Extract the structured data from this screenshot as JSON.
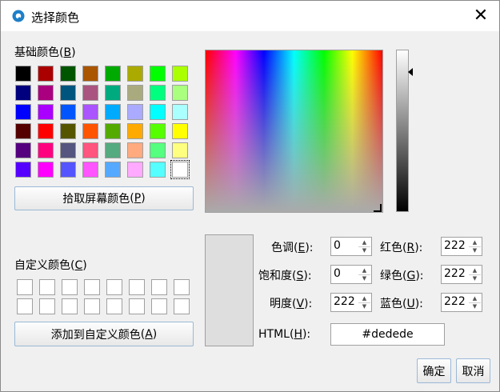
{
  "window": {
    "title": "选择颜色",
    "app_icon": "qt-logo-icon",
    "close_glyph": "✕"
  },
  "basic_colors": {
    "label": "基础颜色",
    "mnemonic": "B",
    "swatches": [
      "#000000",
      "#aa0000",
      "#005500",
      "#aa5500",
      "#00aa00",
      "#aaaa00",
      "#00ff00",
      "#aaff00",
      "#00007f",
      "#aa007f",
      "#00557f",
      "#aa557f",
      "#00aa7f",
      "#aaaa7f",
      "#00ff7f",
      "#aaff7f",
      "#0000ff",
      "#aa00ff",
      "#0055ff",
      "#aa55ff",
      "#00aaff",
      "#aaaaff",
      "#00ffff",
      "#aaffff",
      "#550000",
      "#ff0000",
      "#555500",
      "#ff5500",
      "#55aa00",
      "#ffaa00",
      "#55ff00",
      "#ffff00",
      "#55007f",
      "#ff007f",
      "#55557f",
      "#ff557f",
      "#55aa7f",
      "#ffaa7f",
      "#55ff7f",
      "#ffff7f",
      "#5500ff",
      "#ff00ff",
      "#5555ff",
      "#ff55ff",
      "#55aaff",
      "#ffaaff",
      "#55ffff",
      "#ffffff"
    ],
    "selected_index": 47
  },
  "pick_screen_button": {
    "label": "拾取屏幕颜色",
    "mnemonic": "P"
  },
  "custom_colors": {
    "label": "自定义颜色",
    "mnemonic": "C",
    "count": 16
  },
  "add_custom_button": {
    "label": "添加到自定义颜色",
    "mnemonic": "A"
  },
  "fields": {
    "hue": {
      "label": "色调",
      "mnemonic": "E",
      "value": "0"
    },
    "saturation": {
      "label": "饱和度",
      "mnemonic": "S",
      "value": "0"
    },
    "value": {
      "label": "明度",
      "mnemonic": "V",
      "value": "222"
    },
    "red": {
      "label": "红色",
      "mnemonic": "R",
      "value": "222"
    },
    "green": {
      "label": "绿色",
      "mnemonic": "G",
      "value": "222"
    },
    "blue": {
      "label": "蓝色",
      "mnemonic": "U",
      "value": "222"
    },
    "html": {
      "label": "HTML",
      "mnemonic": "H",
      "value": "#dedede"
    }
  },
  "current_color": "#dedede",
  "ok_button": "确定",
  "cancel_button": "取消"
}
